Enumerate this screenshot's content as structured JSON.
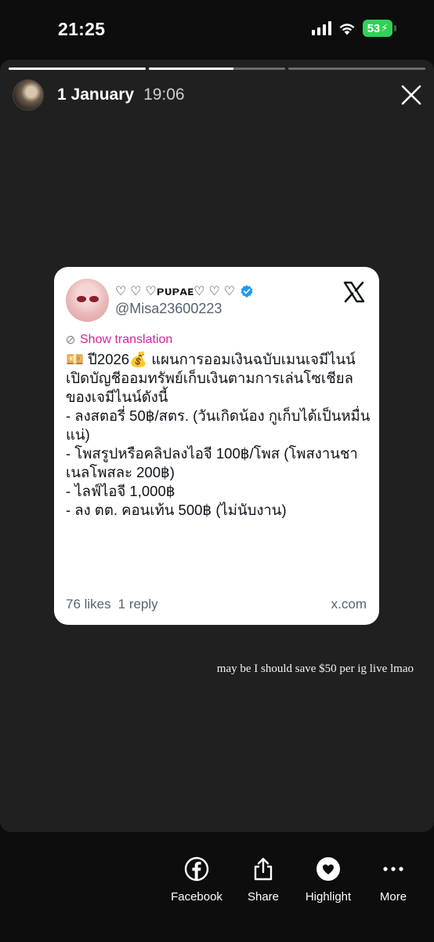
{
  "status_bar": {
    "time": "21:25",
    "battery": "53"
  },
  "story": {
    "progress": [
      1.0,
      0.62,
      0.0
    ],
    "date": "1 January",
    "time": "19:06",
    "tweet": {
      "display_name": "♡ ♡ ♡ᴘᴜᴘᴀᴇ♡ ♡ ♡",
      "handle": "@Misa23600223",
      "show_translation": "Show translation",
      "text": "💴 ปี2026💰 แผนการออมเงินฉบับเมนเจมีไนน์\nเปิดบัญชีออมทรัพย์เก็บเงินตามการเล่นโซเชียลของเจมีไนน์ดังนี้\n- ลงสตอรี่ 50฿/สตร. (วันเกิดน้อง กูเก็บได้เป็นหมื่นแน่)\n- โพสรูปหรือคลิปลงไอจี 100฿/โพส (โพสงานชาเนลโพสละ 200฿)\n- ไลฟ์ไอจี 1,000฿\n-  ลง ตต. คอนเท้น 500฿ (ไม่นับงาน)",
      "likes": "76 likes",
      "replies": "1 reply",
      "source": "x.com"
    },
    "caption": "may be I should save $50 per ig live lmao"
  },
  "actions": [
    {
      "label": "Facebook",
      "icon": "facebook-icon"
    },
    {
      "label": "Share",
      "icon": "share-icon"
    },
    {
      "label": "Highlight",
      "icon": "highlight-heart-icon"
    },
    {
      "label": "More",
      "icon": "more-dots-icon"
    }
  ],
  "colors": {
    "story_bg": "#202020",
    "translation_pink": "#d6249f",
    "battery_green": "#30d158",
    "verified_blue": "#1d9bf0"
  }
}
